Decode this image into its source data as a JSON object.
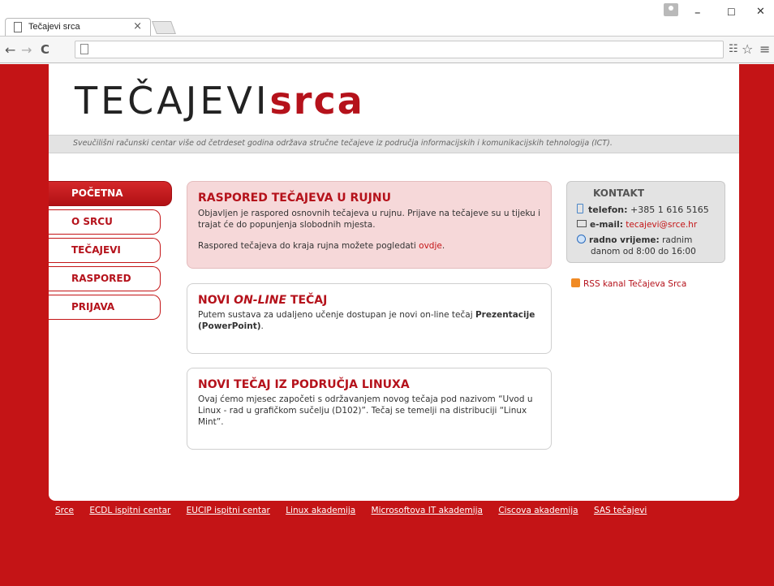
{
  "browser": {
    "tab_title": "Tečajevi srca",
    "tab_close": "×",
    "minimize": "–",
    "maximize": "☐",
    "close": "✕",
    "back": "←",
    "forward": "→",
    "reload": "C",
    "menu": "≡",
    "star": "☆",
    "translate": "☷"
  },
  "header": {
    "logo_main": "TEČAJEVI",
    "logo_accent": "srca",
    "tagline": "Sveučilišni računski centar više od četrdeset godina održava stručne tečajeve iz područja informacijskih i komunikacijskih tehnologija (ICT)."
  },
  "menu": [
    {
      "label": "POČETNA",
      "active": true
    },
    {
      "label": "O SRCU"
    },
    {
      "label": "TEČAJEVI"
    },
    {
      "label": "RASPORED"
    },
    {
      "label": "PRIJAVA"
    }
  ],
  "news": [
    {
      "title": "RASPORED TEČAJEVA U RUJNU",
      "text1": "Objavljen je raspored osnovnih tečajeva u rujnu. Prijave na tečajeve su u tijeku i trajat će do popunjenja slobodnih mjesta.",
      "text2_pre": "Raspored tečajeva do kraja rujna možete pogledati ",
      "text2_link": "ovdje",
      "text2_post": "."
    },
    {
      "title_pre": "NOVI ",
      "title_em": "ON-LINE",
      "title_post": " TEČAJ",
      "text_pre": "Putem sustava za udaljeno učenje dostupan je novi on-line tečaj ",
      "text_bold": "Prezentacije (PowerPoint)",
      "text_post": "."
    },
    {
      "title": "NOVI TEČAJ IZ PODRUČJA LINUXA",
      "text": "Ovaj ćemo mjesec započeti s održavanjem novog tečaja pod nazivom “Uvod u Linux - rad u grafičkom sučelju (D102)”. Tečaj se temelji na distribuciji “Linux Mint”."
    }
  ],
  "kontakt": {
    "title": "KONTAKT",
    "phone_label": "telefon:",
    "phone": "+385 1 616 5165",
    "email_label": "e-mail:",
    "email": "tecajevi@srce.hr",
    "hours_label": "radno vrijeme:",
    "hours_1": "radnim",
    "hours_2": "danom od 8:00 do 16:00"
  },
  "rss": "RSS kanal Tečajeva Srca",
  "footer_links": [
    "Srce",
    "ECDL ispitni centar",
    "EUCIP ispitni centar",
    "Linux akademija",
    "Microsoftova IT akademija",
    "Ciscova akademija",
    "SAS tečajevi"
  ]
}
